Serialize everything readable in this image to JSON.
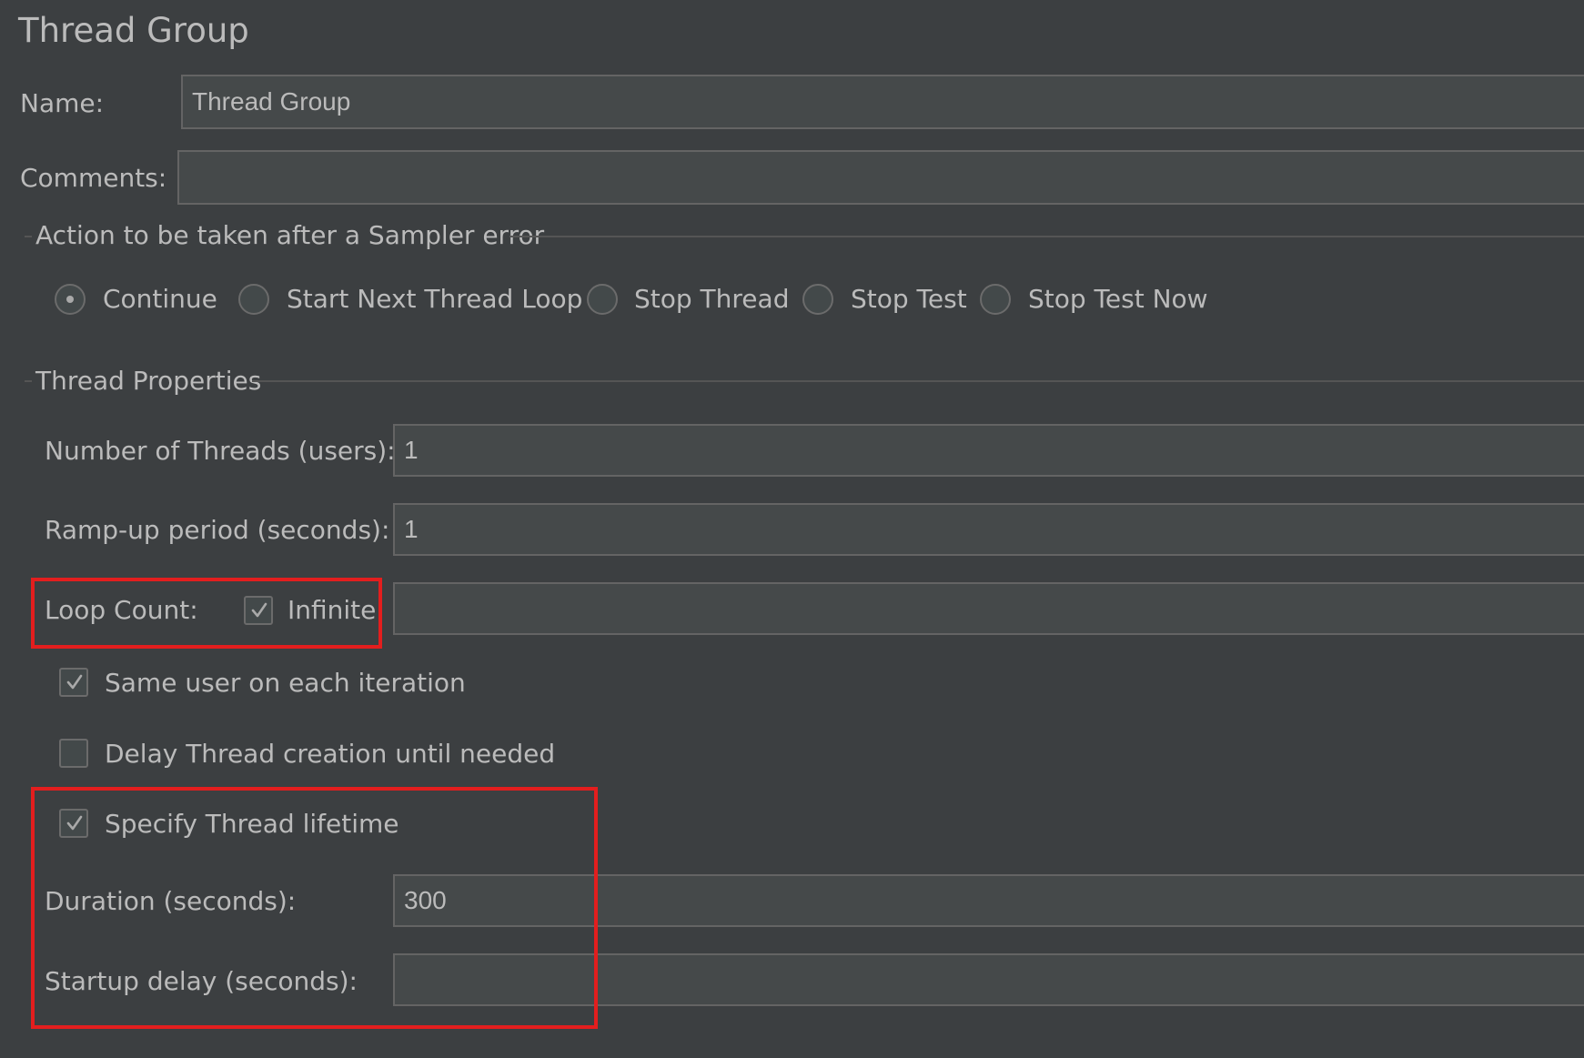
{
  "panel": {
    "title": "Thread Group",
    "name_label": "Name:",
    "name_value": "Thread Group",
    "comments_label": "Comments:",
    "comments_value": ""
  },
  "sampler_error": {
    "legend": "Action to be taken after a Sampler error",
    "options": [
      {
        "label": "Continue",
        "selected": true
      },
      {
        "label": "Start Next Thread Loop",
        "selected": false
      },
      {
        "label": "Stop Thread",
        "selected": false
      },
      {
        "label": "Stop Test",
        "selected": false
      },
      {
        "label": "Stop Test Now",
        "selected": false
      }
    ]
  },
  "thread_properties": {
    "legend": "Thread Properties",
    "threads_label": "Number of Threads (users):",
    "threads_value": "1",
    "rampup_label": "Ramp-up period (seconds):",
    "rampup_value": "1",
    "loop_count_label": "Loop Count:",
    "infinite_label": "Infinite",
    "infinite_checked": true,
    "loop_count_value": "",
    "same_user_label": "Same user on each iteration",
    "same_user_checked": true,
    "delay_creation_label": "Delay Thread creation until needed",
    "delay_creation_checked": false,
    "lifetime_label": "Specify Thread lifetime",
    "lifetime_checked": true,
    "duration_label": "Duration (seconds):",
    "duration_value": "300",
    "startup_delay_label": "Startup delay (seconds):",
    "startup_delay_value": ""
  },
  "colors": {
    "background": "#3c3f41",
    "field_background": "#45494a",
    "text": "#bbbbbb",
    "highlight_box": "#e31e1e"
  }
}
